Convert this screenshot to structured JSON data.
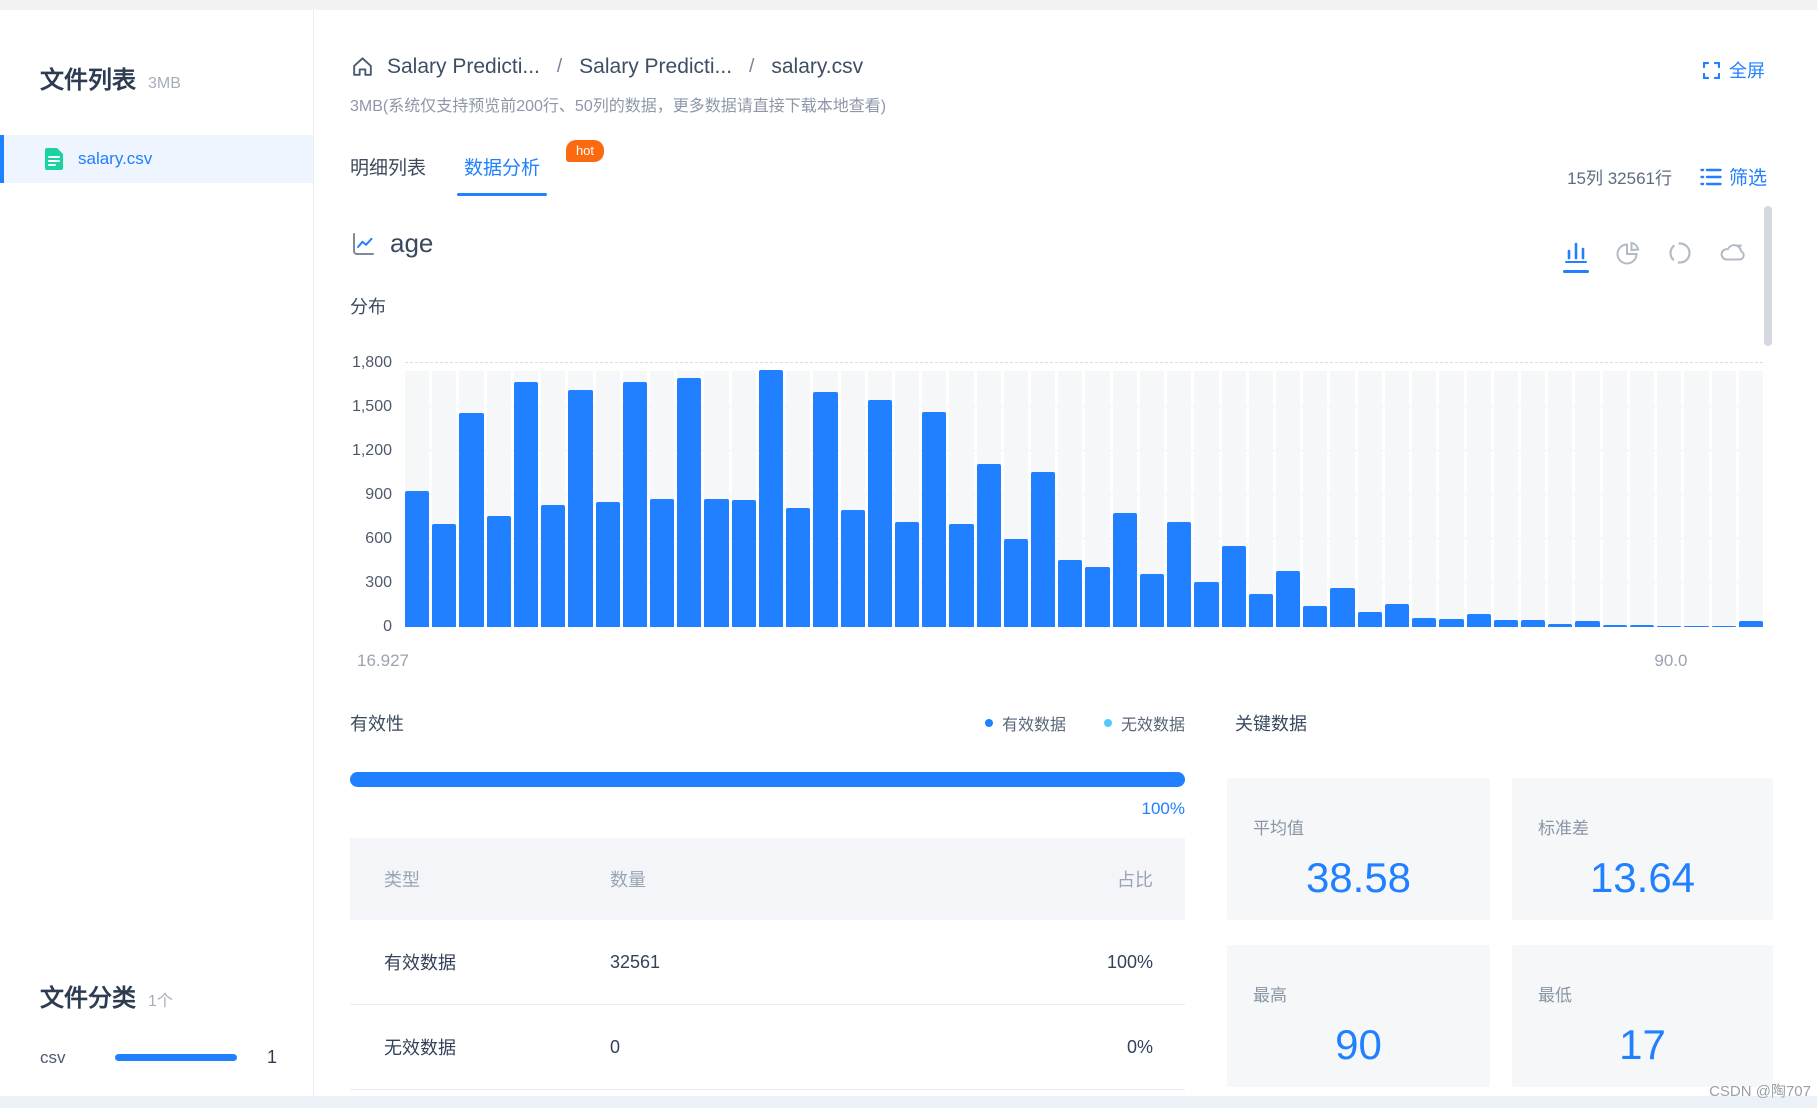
{
  "sidebar": {
    "title": "文件列表",
    "size_badge": "3MB",
    "file": {
      "name": "salary.csv"
    },
    "classify_title": "文件分类",
    "classify_count": "1个",
    "category": {
      "label": "csv",
      "count": "1"
    }
  },
  "header": {
    "breadcrumb": {
      "item1": "Salary Predicti...",
      "item2": "Salary Predicti...",
      "item3": "salary.csv",
      "sep": "/"
    },
    "subtitle": "3MB(系统仅支持预览前200行、50列的数据，更多数据请直接下载本地查看)",
    "fullscreen": "全屏"
  },
  "toolbar": {
    "tab_detail": "明细列表",
    "tab_analysis": "数据分析",
    "hot": "hot",
    "meta": "15列 32561行",
    "filter": "筛选"
  },
  "field": {
    "name": "age",
    "distribution": "分布"
  },
  "chart_data": {
    "type": "bar",
    "title": "age 分布",
    "xlabel": "",
    "ylabel": "",
    "xlim": [
      16.927,
      90.0
    ],
    "ylim": [
      0,
      1800
    ],
    "ytick_labels": [
      "0",
      "300",
      "600",
      "900",
      "1,200",
      "1,500",
      "1,800"
    ],
    "x_start_label": "16.927",
    "x_end_label": "90.0",
    "grid": true,
    "legend_position": "none",
    "bar_color": "#2080ff",
    "track_color": "#f6f7f9",
    "values": [
      930,
      700,
      1460,
      755,
      1670,
      830,
      1615,
      855,
      1670,
      875,
      1700,
      875,
      865,
      1755,
      815,
      1605,
      800,
      1545,
      715,
      1465,
      700,
      1110,
      600,
      1060,
      460,
      410,
      780,
      360,
      715,
      305,
      555,
      225,
      380,
      145,
      265,
      105,
      160,
      60,
      58,
      92,
      46,
      51,
      18,
      39,
      11,
      12,
      3,
      2,
      3,
      40
    ]
  },
  "validity": {
    "title": "有效性",
    "legend_valid": "有效数据",
    "legend_invalid": "无效数据",
    "valid_color": "#2080ff",
    "invalid_color": "#54c8ff",
    "percent": "100%"
  },
  "table": {
    "col_type": "类型",
    "col_count": "数量",
    "col_ratio": "占比",
    "rows": [
      {
        "type": "有效数据",
        "count": "32561",
        "ratio": "100%"
      },
      {
        "type": "无效数据",
        "count": "0",
        "ratio": "0%"
      }
    ]
  },
  "key_stats": {
    "title": "关键数据",
    "cards": [
      {
        "label": "平均值",
        "value": "38.58"
      },
      {
        "label": "标准差",
        "value": "13.64"
      },
      {
        "label": "最高",
        "value": "90"
      },
      {
        "label": "最低",
        "value": "17"
      }
    ]
  },
  "watermark": "CSDN @陶707"
}
